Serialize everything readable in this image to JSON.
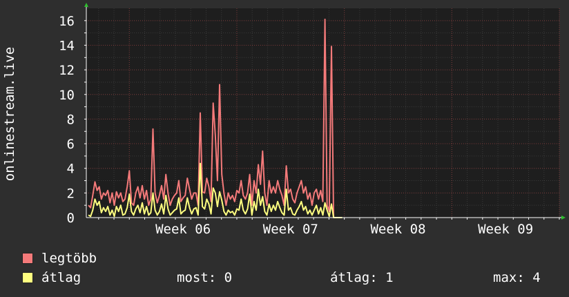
{
  "chart_data": {
    "type": "line",
    "ylabel": "onlinestream.live",
    "ylim": [
      0,
      17
    ],
    "yticks": [
      0,
      2,
      4,
      6,
      8,
      10,
      12,
      14,
      16
    ],
    "x_ticks": [
      "Week 06",
      "Week 07",
      "Week 08",
      "Week 09"
    ],
    "x_range_weeks": [
      5.6,
      10.0
    ],
    "grid": true,
    "series": [
      {
        "name": "legtöbb",
        "color": "#f47a7a",
        "x": [
          5.62,
          5.64,
          5.66,
          5.68,
          5.7,
          5.72,
          5.74,
          5.76,
          5.78,
          5.8,
          5.82,
          5.84,
          5.86,
          5.88,
          5.9,
          5.92,
          5.94,
          5.96,
          5.98,
          6.0,
          6.02,
          6.04,
          6.06,
          6.08,
          6.1,
          6.12,
          6.14,
          6.16,
          6.18,
          6.2,
          6.22,
          6.24,
          6.26,
          6.28,
          6.3,
          6.32,
          6.34,
          6.36,
          6.38,
          6.4,
          6.42,
          6.44,
          6.46,
          6.48,
          6.5,
          6.52,
          6.54,
          6.56,
          6.58,
          6.6,
          6.62,
          6.64,
          6.66,
          6.68,
          6.7,
          6.72,
          6.74,
          6.76,
          6.78,
          6.8,
          6.82,
          6.84,
          6.86,
          6.88,
          6.9,
          6.92,
          6.94,
          6.96,
          6.98,
          7.0,
          7.02,
          7.04,
          7.06,
          7.08,
          7.1,
          7.12,
          7.14,
          7.16,
          7.18,
          7.2,
          7.22,
          7.24,
          7.26,
          7.28,
          7.3,
          7.32,
          7.34,
          7.36,
          7.38,
          7.4,
          7.42,
          7.44,
          7.46,
          7.48,
          7.5,
          7.52,
          7.54,
          7.56,
          7.58,
          7.6,
          7.62,
          7.64,
          7.66,
          7.68,
          7.7,
          7.72,
          7.74,
          7.76,
          7.78,
          7.8,
          7.82,
          7.84,
          7.86,
          7.88,
          7.9,
          7.92,
          7.94,
          7.96,
          7.98
        ],
        "values": [
          1.0,
          0.8,
          1.8,
          2.9,
          2.2,
          2.5,
          1.5,
          2.0,
          1.8,
          2.2,
          1.2,
          2.0,
          1.0,
          2.1,
          1.6,
          2.0,
          1.3,
          1.5,
          2.5,
          3.8,
          1.2,
          1.0,
          2.0,
          2.5,
          1.6,
          2.6,
          1.5,
          2.2,
          1.0,
          1.5,
          7.2,
          2.0,
          1.2,
          1.8,
          2.6,
          1.5,
          3.5,
          2.0,
          1.0,
          1.5,
          1.8,
          2.0,
          3.0,
          1.3,
          1.6,
          1.8,
          3.2,
          2.3,
          1.5,
          2.0,
          2.0,
          1.0,
          8.5,
          2.1,
          2.0,
          3.2,
          2.5,
          1.3,
          9.3,
          6.7,
          3.0,
          10.8,
          3.5,
          2.0,
          1.0,
          2.0,
          1.5,
          1.8,
          1.3,
          2.2,
          2.0,
          3.0,
          1.8,
          1.5,
          2.0,
          3.5,
          1.0,
          3.0,
          2.0,
          4.3,
          2.7,
          5.4,
          2.0,
          1.0,
          3.0,
          2.0,
          2.5,
          2.0,
          3.0,
          2.3,
          1.8,
          1.0,
          4.2,
          2.0,
          2.3,
          1.5,
          1.2,
          2.0,
          2.5,
          3.0,
          2.0,
          2.5,
          1.5,
          2.0,
          1.0,
          2.0,
          2.3,
          1.5,
          2.2,
          1.3,
          16.1,
          1.0,
          0.5,
          13.9,
          0.0,
          0.0,
          0.0,
          0.0,
          0.0
        ]
      },
      {
        "name": "átlag",
        "color": "#ffff80",
        "x": [
          5.62,
          5.64,
          5.66,
          5.68,
          5.7,
          5.72,
          5.74,
          5.76,
          5.78,
          5.8,
          5.82,
          5.84,
          5.86,
          5.88,
          5.9,
          5.92,
          5.94,
          5.96,
          5.98,
          6.0,
          6.02,
          6.04,
          6.06,
          6.08,
          6.1,
          6.12,
          6.14,
          6.16,
          6.18,
          6.2,
          6.22,
          6.24,
          6.26,
          6.28,
          6.3,
          6.32,
          6.34,
          6.36,
          6.38,
          6.4,
          6.42,
          6.44,
          6.46,
          6.48,
          6.5,
          6.52,
          6.54,
          6.56,
          6.58,
          6.6,
          6.62,
          6.64,
          6.66,
          6.68,
          6.7,
          6.72,
          6.74,
          6.76,
          6.78,
          6.8,
          6.82,
          6.84,
          6.86,
          6.88,
          6.9,
          6.92,
          6.94,
          6.96,
          6.98,
          7.0,
          7.02,
          7.04,
          7.06,
          7.08,
          7.1,
          7.12,
          7.14,
          7.16,
          7.18,
          7.2,
          7.22,
          7.24,
          7.26,
          7.28,
          7.3,
          7.32,
          7.34,
          7.36,
          7.38,
          7.4,
          7.42,
          7.44,
          7.46,
          7.48,
          7.5,
          7.52,
          7.54,
          7.56,
          7.58,
          7.6,
          7.62,
          7.64,
          7.66,
          7.68,
          7.7,
          7.72,
          7.74,
          7.76,
          7.78,
          7.8,
          7.82,
          7.84,
          7.86,
          7.88,
          7.9,
          7.92,
          7.94,
          7.96,
          7.98
        ],
        "values": [
          0.2,
          0.1,
          0.6,
          1.5,
          1.0,
          1.3,
          0.4,
          0.8,
          0.5,
          0.9,
          0.2,
          0.6,
          0.1,
          0.9,
          0.5,
          1.0,
          0.2,
          0.3,
          0.8,
          1.9,
          0.5,
          0.2,
          0.7,
          1.0,
          0.4,
          1.2,
          0.3,
          0.9,
          0.2,
          0.4,
          2.0,
          0.6,
          0.2,
          0.5,
          1.1,
          0.3,
          1.8,
          0.7,
          0.2,
          0.4,
          0.6,
          0.7,
          1.6,
          0.3,
          0.5,
          0.6,
          1.6,
          0.8,
          0.3,
          0.7,
          0.8,
          0.2,
          4.4,
          0.9,
          0.7,
          1.5,
          1.1,
          0.3,
          2.4,
          2.0,
          0.9,
          2.1,
          1.4,
          0.5,
          0.2,
          0.6,
          0.4,
          0.5,
          0.2,
          0.7,
          0.6,
          1.5,
          0.6,
          0.3,
          0.7,
          1.9,
          0.2,
          1.3,
          0.6,
          2.3,
          1.0,
          1.7,
          0.5,
          0.2,
          1.1,
          0.5,
          1.0,
          0.6,
          1.3,
          0.8,
          0.4,
          0.2,
          2.3,
          0.6,
          0.8,
          0.3,
          0.2,
          0.6,
          0.9,
          1.3,
          0.6,
          0.9,
          0.3,
          0.6,
          0.2,
          0.6,
          1.0,
          0.3,
          0.8,
          0.2,
          1.2,
          0.6,
          0.1,
          1.1,
          0.0,
          0.0,
          0.0,
          0.0,
          0.0
        ]
      }
    ]
  },
  "legend": {
    "max_label": "legtöbb",
    "avg_label": "átlag",
    "max_color": "#f47a7a",
    "avg_color": "#ffff80"
  },
  "stats": {
    "now": "most: 0",
    "avg": "átlag: 1",
    "max": "max: 4"
  }
}
